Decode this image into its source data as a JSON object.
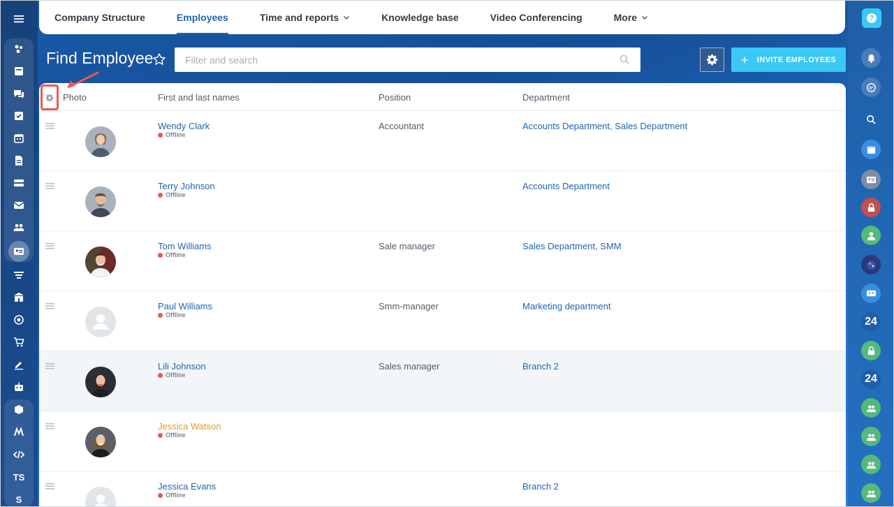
{
  "top_nav": {
    "tabs": [
      {
        "label": "Company Structure"
      },
      {
        "label": "Employees"
      },
      {
        "label": "Time and reports"
      },
      {
        "label": "Knowledge base"
      },
      {
        "label": "Video Conferencing"
      },
      {
        "label": "More"
      }
    ],
    "active_tab": "Employees"
  },
  "header": {
    "title": "Find Employee",
    "search_placeholder": "Filter and search",
    "invite_label": "INVITE EMPLOYEES"
  },
  "grid": {
    "columns": [
      "Photo",
      "First and last names",
      "Position",
      "Department"
    ],
    "rows": [
      {
        "name": "Wendy Clark",
        "status": "Offline",
        "position": "Accountant",
        "department": "Accounts Department, Sales Department",
        "avatar": "photo-female-1"
      },
      {
        "name": "Terry Johnson",
        "status": "Offline",
        "position": "",
        "department": "Accounts Department",
        "avatar": "photo-male-1"
      },
      {
        "name": "Tom Williams",
        "status": "Offline",
        "position": "Sale manager",
        "department": "Sales Department, SMM",
        "avatar": "photo-male-2"
      },
      {
        "name": "Paul Williams",
        "status": "Offline",
        "position": "Smm-manager",
        "department": "Marketing department",
        "avatar": "placeholder"
      },
      {
        "name": "Lili Johnson",
        "status": "Offline",
        "position": "Sales manager",
        "department": "Branch 2",
        "avatar": "photo-female-2"
      },
      {
        "name": "Jessica Watson",
        "status": "Offline",
        "position": "",
        "department": "",
        "avatar": "photo-female-3"
      },
      {
        "name": "Jessica Evans",
        "status": "Offline",
        "position": "",
        "department": "Branch 2",
        "avatar": "placeholder"
      }
    ]
  },
  "left_rail": {
    "text_items": [
      "TS",
      "S"
    ]
  },
  "right_rail": {
    "badges": [
      "24",
      "24"
    ]
  },
  "colors": {
    "accent": "#2066b0",
    "invite": "#3bc8f5",
    "offline": "#f0584e",
    "annotation": "#f0584e",
    "extranet_name": "#e09a2b"
  }
}
